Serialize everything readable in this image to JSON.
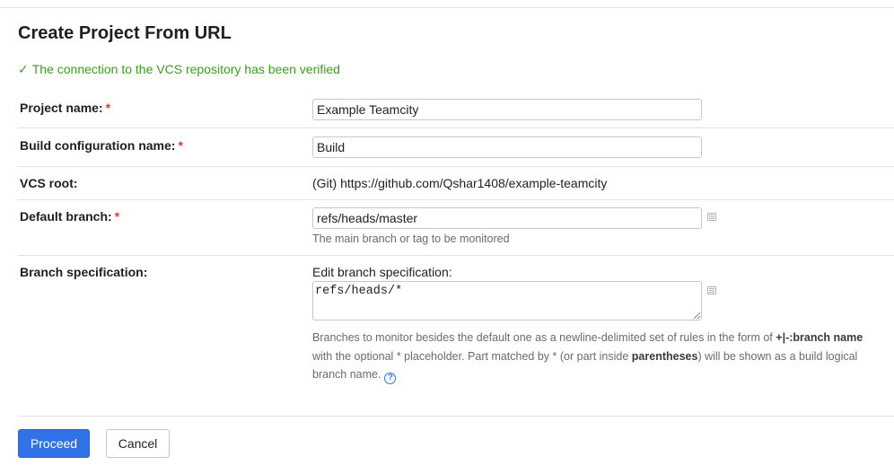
{
  "page": {
    "title": "Create Project From URL",
    "verified_icon": "check-icon",
    "verified_message": "The connection to the VCS repository has been verified"
  },
  "form": {
    "required_mark": "*",
    "project_name": {
      "label": "Project name:",
      "value": "Example Teamcity"
    },
    "build_config_name": {
      "label": "Build configuration name:",
      "value": "Build"
    },
    "vcs_root": {
      "label": "VCS root:",
      "value": "(Git) https://github.com/Qshar1408/example-teamcity"
    },
    "default_branch": {
      "label": "Default branch:",
      "value": "refs/heads/master",
      "hint": "The main branch or tag to be monitored",
      "icon": "list-icon"
    },
    "branch_spec": {
      "label": "Branch specification:",
      "edit_label": "Edit branch specification:",
      "value": "refs/heads/*",
      "icon": "list-icon",
      "desc_1": "Branches to monitor besides the default one as a newline-delimited set of rules in the form of ",
      "desc_rule": "+|-:branch name",
      "desc_2": " with the optional ",
      "desc_star": "*",
      "desc_3": " placeholder. Part matched by ",
      "desc_4": " (or part inside ",
      "desc_parens": "parentheses",
      "desc_5": ") will be shown as a build logical branch name.",
      "help_glyph": "?",
      "help_icon": "help-icon"
    }
  },
  "actions": {
    "proceed_label": "Proceed",
    "cancel_label": "Cancel"
  },
  "colors": {
    "accent": "#3173e6",
    "success": "#3f9e1e",
    "required": "#e3372f",
    "hint_text": "#6b6b6b",
    "border": "#c8c8c8",
    "divider": "#e3e3e3"
  }
}
